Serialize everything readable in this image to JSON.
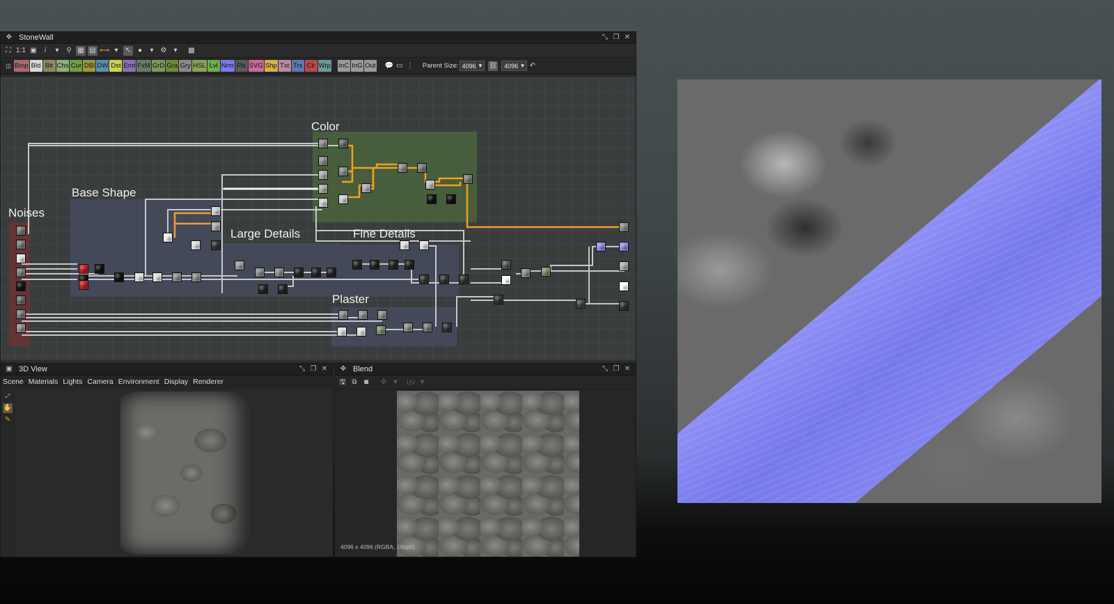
{
  "graph_window": {
    "title": "StoneWall",
    "toolbar_zoom_label": "1:1",
    "node_buttons": [
      {
        "label": "Bmp",
        "color": "#a86b6b"
      },
      {
        "label": "Bld",
        "color": "#d8d8d8"
      },
      {
        "label": "Blr",
        "color": "#8a8a60"
      },
      {
        "label": "Chs",
        "color": "#8fb07a"
      },
      {
        "label": "Cur",
        "color": "#6fa048"
      },
      {
        "label": "DBl",
        "color": "#9a9a3a"
      },
      {
        "label": "DW",
        "color": "#5a8fb0"
      },
      {
        "label": "Dst",
        "color": "#c8d64a"
      },
      {
        "label": "Emt",
        "color": "#8e6fb8"
      },
      {
        "label": "FxM",
        "color": "#6a7a6a"
      },
      {
        "label": "GrD",
        "color": "#7a9a5a"
      },
      {
        "label": "Gra",
        "color": "#6a8a3a"
      },
      {
        "label": "Gry",
        "color": "#8a8a8a"
      },
      {
        "label": "HSL",
        "color": "#8aa05a"
      },
      {
        "label": "Lvl",
        "color": "#6ab04a"
      },
      {
        "label": "Nrm",
        "color": "#7a7aee"
      },
      {
        "label": "Plx",
        "color": "#5a5a5a"
      },
      {
        "label": "SVG",
        "color": "#c86a9a"
      },
      {
        "label": "Shp",
        "color": "#d8b04a"
      },
      {
        "label": "Txt",
        "color": "#b88aa0"
      },
      {
        "label": "Trs",
        "color": "#5a7ab0"
      },
      {
        "label": "Clr",
        "color": "#b84a4a"
      },
      {
        "label": "Wrp",
        "color": "#6a9a9a"
      }
    ],
    "io_buttons": [
      {
        "label": "InC",
        "color": "#9a9a9a"
      },
      {
        "label": "InG",
        "color": "#9a9a9a"
      },
      {
        "label": "Out",
        "color": "#9a9a9a"
      }
    ],
    "parent_size_label": "Parent Size:",
    "parent_width": "4096",
    "parent_height": "4096",
    "frames": {
      "noises": "Noises",
      "base_shape": "Base Shape",
      "color": "Color",
      "large_details": "Large Details",
      "fine_details": "Fine Details",
      "plaster": "Plaster"
    },
    "colors": {
      "highlight_wire": "#f0a020",
      "wire": "#c8c8c8",
      "noises_frame": "#7a3a36",
      "base_frame": "#4a5068",
      "color_frame": "#4e6a3e"
    }
  },
  "view3d": {
    "title": "3D View",
    "menus": [
      "Scene",
      "Materials",
      "Lights",
      "Camera",
      "Environment",
      "Display",
      "Renderer"
    ]
  },
  "blend": {
    "title": "Blend",
    "uv_label": "UV",
    "status": "4096 x 4096 (RGBA, 16bpc)"
  },
  "preview": {
    "colors": {
      "normal_map": "#7a7ef0",
      "grey_noise": "#6a6a6a"
    }
  }
}
